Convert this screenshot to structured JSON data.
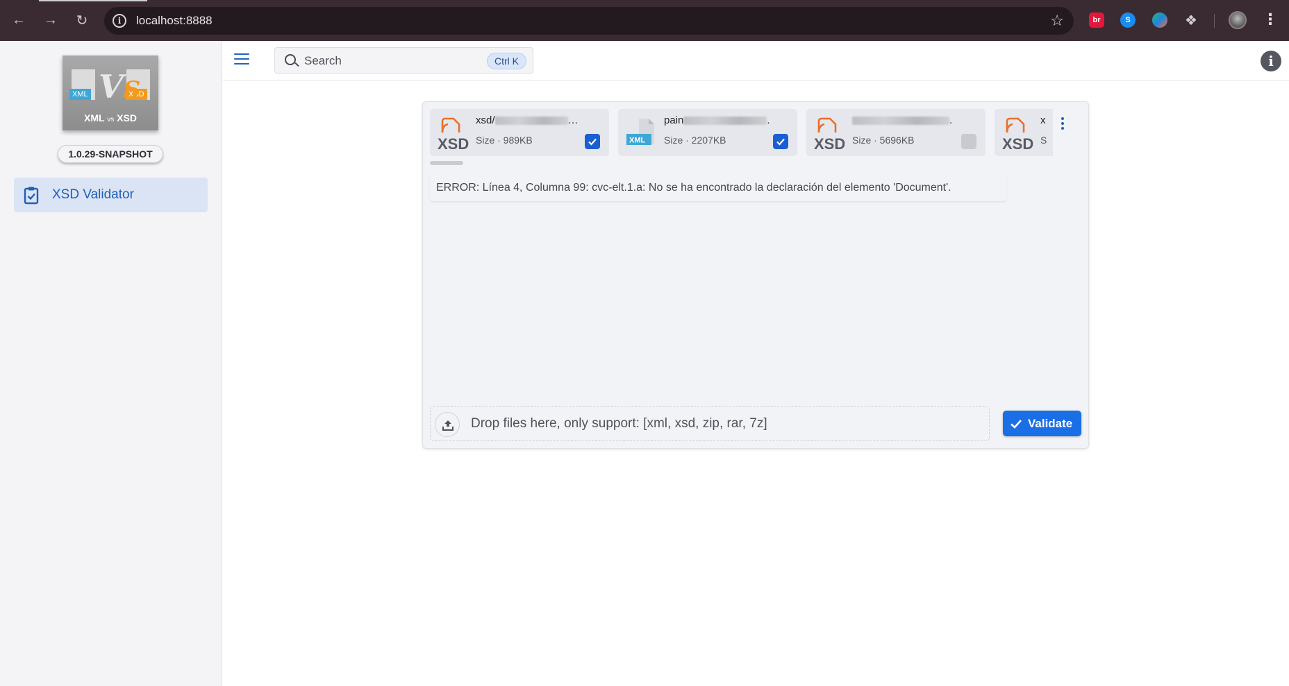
{
  "browser": {
    "url": "localhost:8888",
    "colors": {
      "frame": "#3a2b33",
      "omnibox": "#221a1f"
    },
    "extensions": [
      {
        "name": "br",
        "label": "br"
      },
      {
        "name": "shazam",
        "label": "S"
      },
      {
        "name": "colorful",
        "label": ""
      },
      {
        "name": "puzzle-icon",
        "label": ""
      }
    ]
  },
  "sidebar": {
    "logo": {
      "xml_tag": "XML",
      "xsd_tag": "XSD",
      "vs_v": "V",
      "vs_s": "S",
      "caption_left": "XML",
      "caption_mid": "vs",
      "caption_right": "XSD"
    },
    "version": "1.0.29-SNAPSHOT",
    "nav_items": [
      {
        "label": "XSD Validator",
        "icon": "clipboard-check-icon",
        "active": true
      }
    ]
  },
  "topbar": {
    "search_placeholder": "Search",
    "search_shortcut": "Ctrl K"
  },
  "files": [
    {
      "type": "XSD",
      "name_prefix": "xsd/",
      "name_suffix": "…",
      "size": "Size · 989KB",
      "checked": true
    },
    {
      "type": "XML",
      "name_prefix": "pain",
      "name_suffix": ".",
      "size": "Size · 2207KB",
      "checked": true
    },
    {
      "type": "XSD",
      "name_prefix": "",
      "name_suffix": ".",
      "size": "Size · 5696KB",
      "checked": false
    },
    {
      "type": "XSD",
      "name_prefix": "x",
      "name_suffix": "",
      "size": "S",
      "checked": false
    }
  ],
  "error_message": "ERROR: Línea 4, Columna 99: cvc-elt.1.a: No se ha encontrado la declaración del elemento 'Document'.",
  "dropzone_hint": "Drop files here, only support: [xml, xsd, zip, rar, 7z]",
  "validate_label": "Validate",
  "colors": {
    "accent": "#1a6ee6",
    "nav_active_bg": "#dbe4f4",
    "xsd_orange": "#e8702a",
    "xml_blue": "#3ea7d7"
  }
}
